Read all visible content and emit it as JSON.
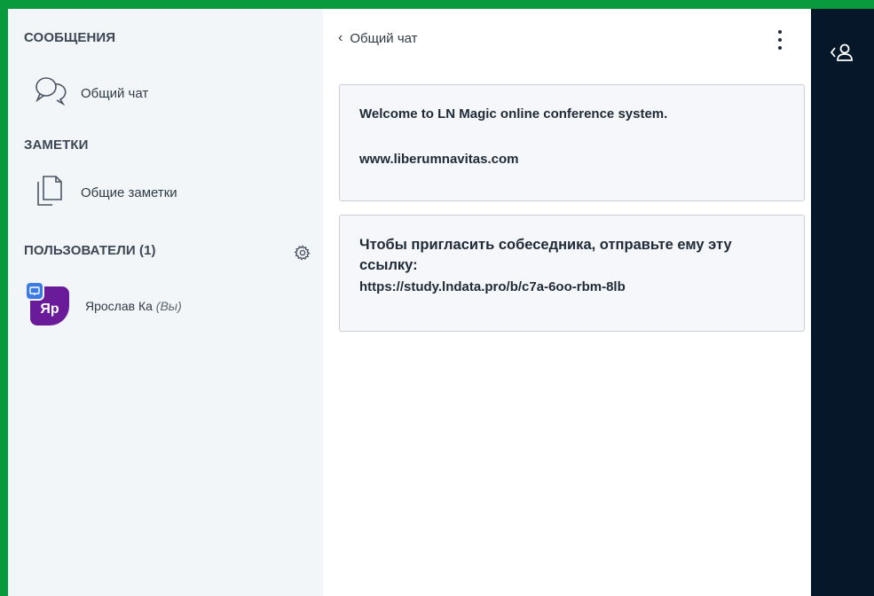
{
  "sidebar": {
    "messages_title": "СООБЩЕНИЯ",
    "public_chat_label": "Общий чат",
    "notes_title": "ЗАМЕТКИ",
    "shared_notes_label": "Общие заметки",
    "users_title": "ПОЛЬЗОВАТЕЛИ (1)",
    "users": [
      {
        "initials": "Яр",
        "name": "Ярослав Ка",
        "you_tag": "(Вы)"
      }
    ]
  },
  "chat": {
    "back_icon": "‹",
    "title": "Общий чат",
    "messages": [
      {
        "line1": "Welcome to LN Magic online conference system.",
        "line2": "www.liberumnavitas.com"
      },
      {
        "text": "Чтобы пригласить собеседника, отправьте ему эту ссылку:",
        "url": "https://study.lndata.pro/b/c7a-6oo-rbm-8lb"
      }
    ]
  },
  "icons": {
    "chat": "chat-bubbles-icon",
    "notes": "notes-icon",
    "settings": "gear-icon",
    "menu": "kebab-menu-icon",
    "users_toggle": "user-toggle-icon"
  },
  "colors": {
    "frame": "#0a9a3e",
    "avatar": "#6a1b9a",
    "presenter": "#3c7be3",
    "rightbar": "#06172a"
  }
}
